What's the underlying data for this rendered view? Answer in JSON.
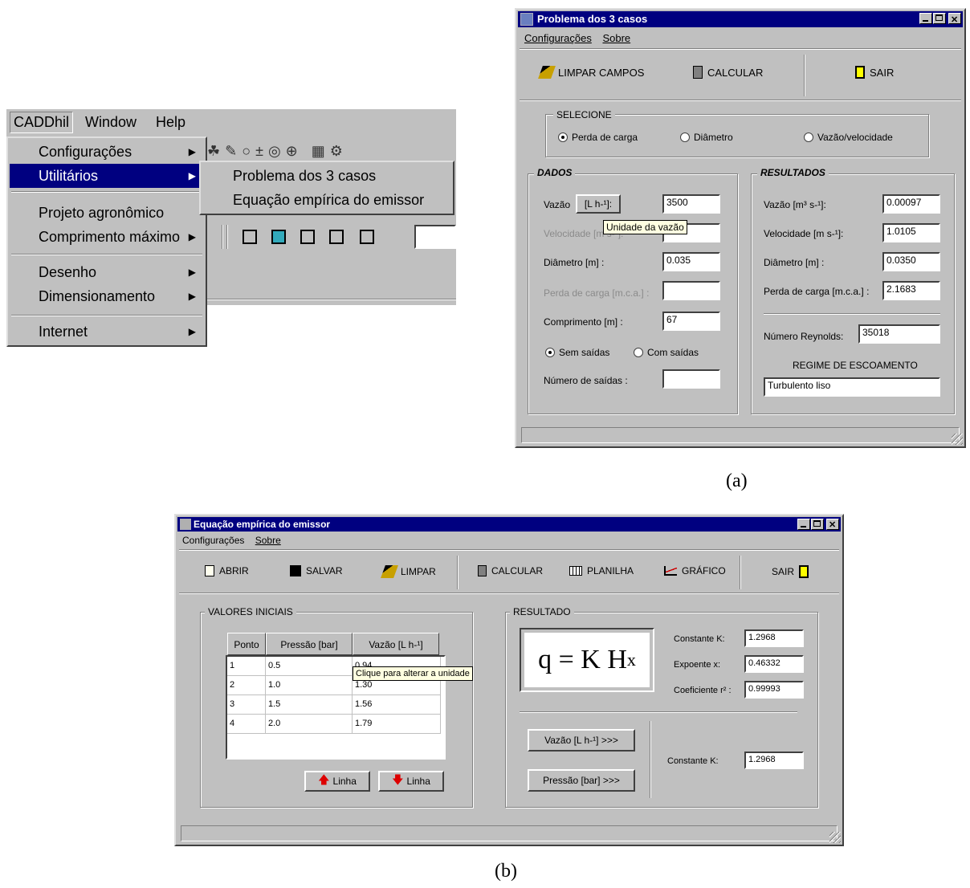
{
  "caddhil": {
    "menubar": [
      "CADDhil",
      "Window",
      "Help"
    ],
    "menu_items": [
      "Configurações",
      "Utilitários",
      "Projeto agronômico",
      "Comprimento máximo",
      "Desenho",
      "Dimensionamento",
      "Internet"
    ],
    "submenu_items": [
      "Problema dos 3 casos",
      "Equação empírica do emissor"
    ]
  },
  "win_a": {
    "title": "Problema dos 3 casos",
    "menu": [
      "Configurações",
      "Sobre"
    ],
    "toolbar": {
      "limpar": "LIMPAR CAMPOS",
      "calcular": "CALCULAR",
      "sair": "SAIR"
    },
    "selecione": {
      "legend": "SELECIONE",
      "options": [
        "Perda de carga",
        "Diâmetro",
        "Vazão/velocidade"
      ],
      "selected": "Perda de carga"
    },
    "dados": {
      "legend": "DADOS",
      "vazao_label": "Vazão",
      "vazao_unit_button": "[L h-¹]:",
      "vazao_value": "3500",
      "velocidade_label": "Velocidade [m s-¹]:",
      "velocidade_value": "",
      "diametro_label": "Diâmetro [m] :",
      "diametro_value": "0.035",
      "perda_label": "Perda de carga [m.c.a.] :",
      "perda_value": "",
      "comprimento_label": "Comprimento [m] :",
      "comprimento_value": "67",
      "saidas_options": [
        "Sem saídas",
        "Com saídas"
      ],
      "saidas_selected": "Sem saídas",
      "num_saidas_label": "Número de saídas :",
      "num_saidas_value": "",
      "tooltip": "Unidade da vazão"
    },
    "resultados": {
      "legend": "RESULTADOS",
      "vazao_label": "Vazão  [m³ s-¹]:",
      "vazao_value": "0.00097",
      "velocidade_label": "Velocidade [m s-¹]:",
      "velocidade_value": "1.0105",
      "diametro_label": "Diâmetro [m] :",
      "diametro_value": "0.0350",
      "perda_label": "Perda de carga [m.c.a.] :",
      "perda_value": "2.1683",
      "reynolds_label": "Número Reynolds:",
      "reynolds_value": "35018",
      "regime_label": "REGIME DE ESCOAMENTO",
      "regime_value": "Turbulento liso"
    }
  },
  "win_b": {
    "title": "Equação empírica do emissor",
    "menu": [
      "Configurações",
      "Sobre"
    ],
    "toolbar": {
      "abrir": "ABRIR",
      "salvar": "SALVAR",
      "limpar": "LIMPAR",
      "calcular": "CALCULAR",
      "planilha": "PLANILHA",
      "grafico": "GRÁFICO",
      "sair": "SAIR"
    },
    "valores": {
      "legend": "VALORES INICIAIS",
      "headers": [
        "Ponto",
        "Pressão [bar]",
        "Vazão [L h-¹]"
      ],
      "rows": [
        [
          "1",
          "0.5",
          "0.94"
        ],
        [
          "2",
          "1.0",
          "1.30"
        ],
        [
          "3",
          "1.5",
          "1.56"
        ],
        [
          "4",
          "2.0",
          "1.79"
        ]
      ],
      "add_row": "Linha",
      "del_row": "Linha",
      "tooltip": "Clique para alterar a unidade"
    },
    "resultado": {
      "legend": "RESULTADO",
      "formula_base": "q = K H",
      "formula_exp": "x",
      "k_label": "Constante K:",
      "k_value": "1.2968",
      "x_label": "Expoente x:",
      "x_value": "0.46332",
      "r2_label": "Coeficiente r² :",
      "r2_value": "0.99993",
      "vazao_button": "Vazão [L h-¹] >>>",
      "pressao_button": "Pressão [bar] >>>",
      "k2_label": "Constante K:",
      "k2_value": "1.2968"
    }
  },
  "captions": {
    "a": "(a)",
    "b": "(b)"
  }
}
